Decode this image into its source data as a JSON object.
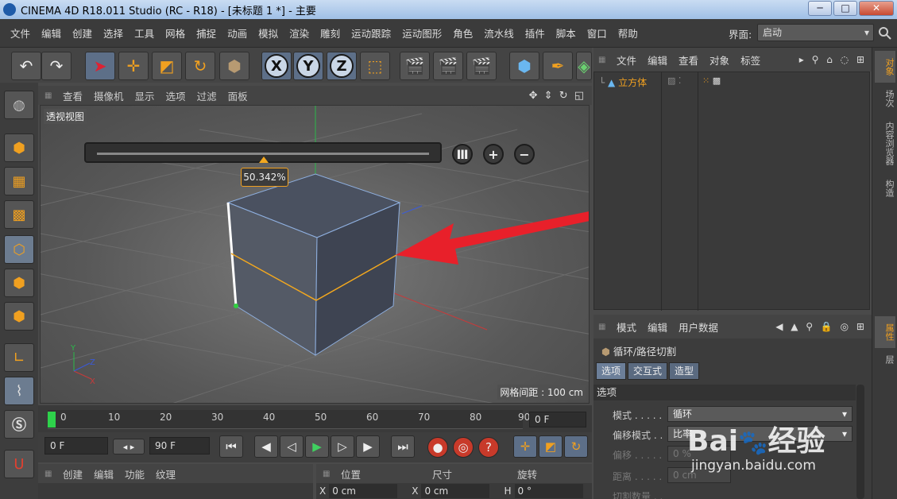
{
  "window": {
    "title": "CINEMA 4D R18.011 Studio (RC - R18) - [未标题 1 *] - 主要",
    "buttons": [
      "─",
      "□",
      "✕"
    ]
  },
  "menu": {
    "items": [
      "文件",
      "编辑",
      "创建",
      "选择",
      "工具",
      "网格",
      "捕捉",
      "动画",
      "模拟",
      "渲染",
      "雕刻",
      "运动跟踪",
      "运动图形",
      "角色",
      "流水线",
      "插件",
      "脚本",
      "窗口",
      "帮助"
    ],
    "layout_label": "界面:",
    "layout_value": "启动"
  },
  "toolbar": {
    "axis_x": "X",
    "axis_y": "Y",
    "axis_z": "Z"
  },
  "viewport": {
    "menu": [
      "查看",
      "摄像机",
      "显示",
      "选项",
      "过滤",
      "面板"
    ],
    "label": "透视视图",
    "grid_info": "网格间距 : 100 cm",
    "slider_percent": 0.50342,
    "slider_value_text": "50.342%",
    "axis_labels": {
      "x": "X",
      "y": "Y",
      "z": "Z"
    }
  },
  "timeline": {
    "ticks": [
      "0",
      "10",
      "20",
      "30",
      "40",
      "50",
      "60",
      "70",
      "80",
      "90"
    ],
    "current_frame": "0 F"
  },
  "transport": {
    "start_frame": "0 F",
    "end_frame": "90 F"
  },
  "material_manager": {
    "menu": [
      "创建",
      "编辑",
      "功能",
      "纹理"
    ]
  },
  "coordinates": {
    "headers": [
      "位置",
      "尺寸",
      "旋转"
    ],
    "fields": [
      {
        "axis": "X",
        "value": "0 cm"
      },
      {
        "axis": "X",
        "value": "0 cm"
      },
      {
        "axis": "H",
        "value": "0 °"
      }
    ]
  },
  "object_manager": {
    "menu": [
      "文件",
      "编辑",
      "查看",
      "对象",
      "标签"
    ],
    "objects": [
      {
        "name": "立方体"
      }
    ]
  },
  "right_tabs": [
    "对象",
    "场次",
    "内容浏览器",
    "构造",
    "属性",
    "层"
  ],
  "attribute_manager": {
    "menu": [
      "模式",
      "编辑",
      "用户数据"
    ],
    "object_title": "循环/路径切割",
    "tabs": [
      "选项",
      "交互式",
      "造型"
    ],
    "section": "选项",
    "props": [
      {
        "label": "模式 . . . . .",
        "value": "循环"
      },
      {
        "label": "偏移模式 . .",
        "value": "比率"
      },
      {
        "label": "偏移 . . . . .",
        "value": "0 %"
      },
      {
        "label": "距离 . . . . .",
        "value": "0 cm"
      },
      {
        "label": "切割数量 . .",
        "value": ""
      }
    ]
  },
  "watermark": {
    "logo": "Bai du 经验",
    "url": "jingyan.baidu.com"
  },
  "colors": {
    "accent": "#f0a020",
    "selection_edge": "#f3a81e",
    "arrow": "#e8202a"
  }
}
